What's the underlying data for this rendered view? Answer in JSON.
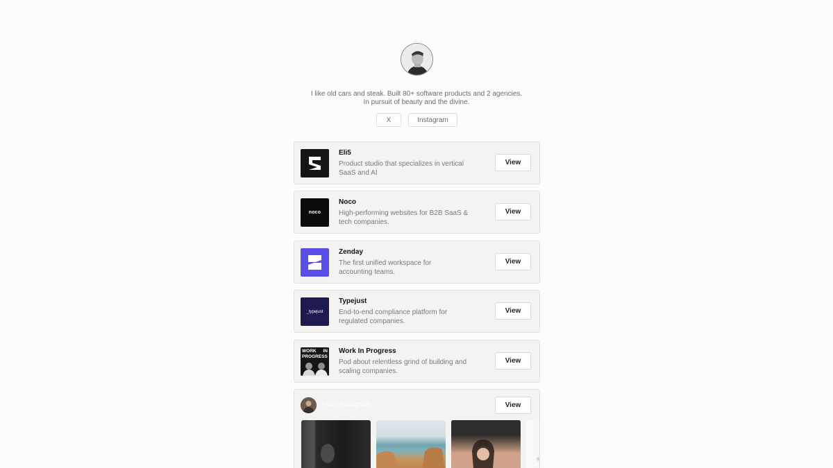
{
  "profile": {
    "bio_line1": "I like old cars and steak. Built 80+ software products and 2 agencies.",
    "bio_line2": "In pursuit of beauty and the divine."
  },
  "social": {
    "x_label": "X",
    "instagram_label": "Instagram"
  },
  "projects": [
    {
      "title": "Eli5",
      "desc_line1": "Product studio that specializes in vertical",
      "desc_line2": "SaaS and AI",
      "button": "View"
    },
    {
      "title": "Noco",
      "logo_text": "noco",
      "desc_line1": "High-performing websites for B2B SaaS &",
      "desc_line2": "tech companies.",
      "button": "View"
    },
    {
      "title": "Zenday",
      "desc_line1": "The first unified workspace  for",
      "desc_line2": "accounting teams.",
      "button": "View"
    },
    {
      "title": "Typejust",
      "logo_text": "_typejust",
      "desc_line1": "End-to-end compliance platform for",
      "desc_line2": "regulated companies.",
      "button": "View"
    },
    {
      "title": "Work In Progress",
      "logo_line1_left": "WORK",
      "logo_line1_right": "IN",
      "logo_line2": "PROGRESS",
      "desc_line1": "Pod about relentless grind of building and",
      "desc_line2": "scaling companies.",
      "button": "View"
    }
  ],
  "instagram": {
    "title": "From Instagram",
    "button": "View"
  },
  "colors": {
    "zenday_purple": "#5b4ee6",
    "typejust_navy": "#1c1a4f"
  }
}
